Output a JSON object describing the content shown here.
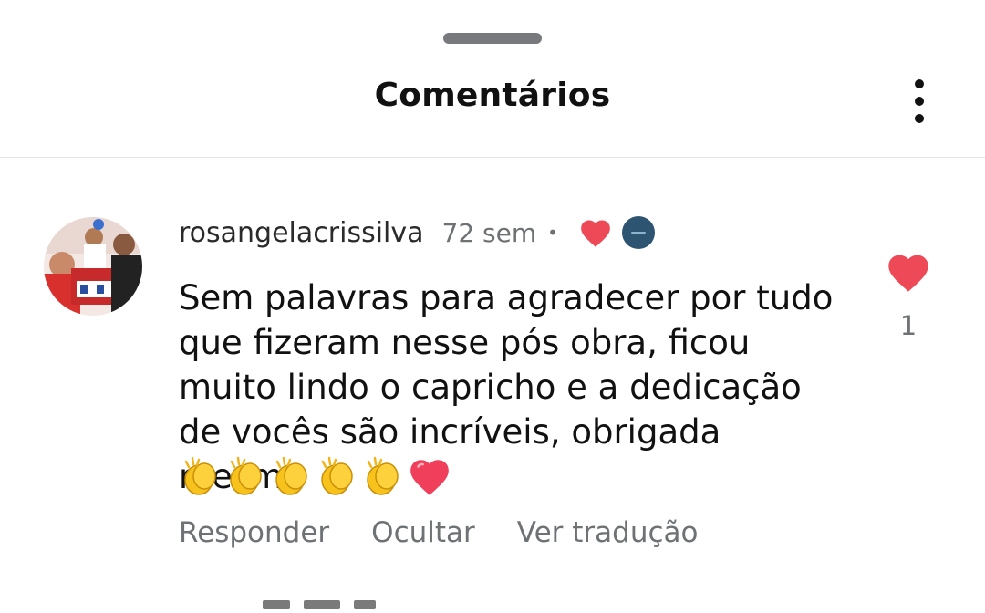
{
  "header": {
    "title": "Comentários",
    "more_icon": "more-vertical-icon"
  },
  "comment": {
    "username": "rosangelacrissilva",
    "time": "72 sem",
    "separator": "•",
    "author_liked": true,
    "text": "Sem palavras para agradecer por tudo que fizeram nesse pós obra, ficou muito lindo o capricho e a dedicação de vocês são incríveis, obrigada mesmo",
    "emojis": [
      "clapping-hands",
      "clapping-hands",
      "clapping-hands",
      "clapping-hands",
      "clapping-hands",
      "red-heart"
    ],
    "like_count": "1",
    "actions": {
      "reply": "Responder",
      "hide": "Ocultar",
      "translate": "Ver tradução"
    }
  },
  "colors": {
    "heart_red": "#ed4956",
    "muted_text": "#6f7275",
    "handle": "#77797c",
    "mini_avatar": "#2d5470"
  }
}
